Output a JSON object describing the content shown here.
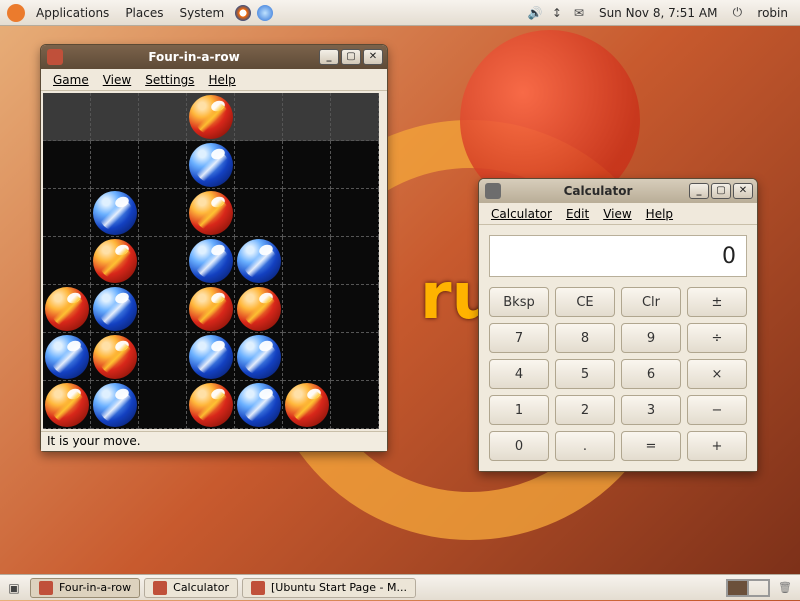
{
  "panel": {
    "menus": [
      "Applications",
      "Places",
      "System"
    ],
    "date": "Sun Nov  8,  7:51 AM",
    "user": "robin"
  },
  "four": {
    "title": "Four-in-a-row",
    "menus": [
      "Game",
      "View",
      "Settings",
      "Help"
    ],
    "status": "It is your move.",
    "board_cols": 7,
    "board_rows": 7,
    "top_row_piece": {
      "col": 3,
      "color": "red"
    },
    "pieces": [
      {
        "row": 1,
        "col": 3,
        "color": "blue"
      },
      {
        "row": 2,
        "col": 1,
        "color": "blue"
      },
      {
        "row": 2,
        "col": 3,
        "color": "red"
      },
      {
        "row": 3,
        "col": 1,
        "color": "red"
      },
      {
        "row": 3,
        "col": 3,
        "color": "blue"
      },
      {
        "row": 3,
        "col": 4,
        "color": "blue"
      },
      {
        "row": 4,
        "col": 0,
        "color": "red"
      },
      {
        "row": 4,
        "col": 1,
        "color": "blue"
      },
      {
        "row": 4,
        "col": 3,
        "color": "red"
      },
      {
        "row": 4,
        "col": 4,
        "color": "red"
      },
      {
        "row": 5,
        "col": 0,
        "color": "blue"
      },
      {
        "row": 5,
        "col": 1,
        "color": "red"
      },
      {
        "row": 5,
        "col": 3,
        "color": "blue"
      },
      {
        "row": 5,
        "col": 4,
        "color": "blue"
      },
      {
        "row": 6,
        "col": 0,
        "color": "red"
      },
      {
        "row": 6,
        "col": 1,
        "color": "blue"
      },
      {
        "row": 6,
        "col": 3,
        "color": "red"
      },
      {
        "row": 6,
        "col": 4,
        "color": "blue"
      },
      {
        "row": 6,
        "col": 5,
        "color": "red"
      }
    ]
  },
  "calc": {
    "title": "Calculator",
    "menus": [
      "Calculator",
      "Edit",
      "View",
      "Help"
    ],
    "display": "0",
    "keys": [
      "Bksp",
      "CE",
      "Clr",
      "±",
      "7",
      "8",
      "9",
      "÷",
      "4",
      "5",
      "6",
      "×",
      "1",
      "2",
      "3",
      "−",
      "0",
      ".",
      "=",
      "+"
    ]
  },
  "taskbar": {
    "tasks": [
      {
        "label": "Four-in-a-row",
        "active": true
      },
      {
        "label": "Calculator",
        "active": false
      },
      {
        "label": "[Ubuntu Start Page - M...",
        "active": false
      }
    ]
  }
}
